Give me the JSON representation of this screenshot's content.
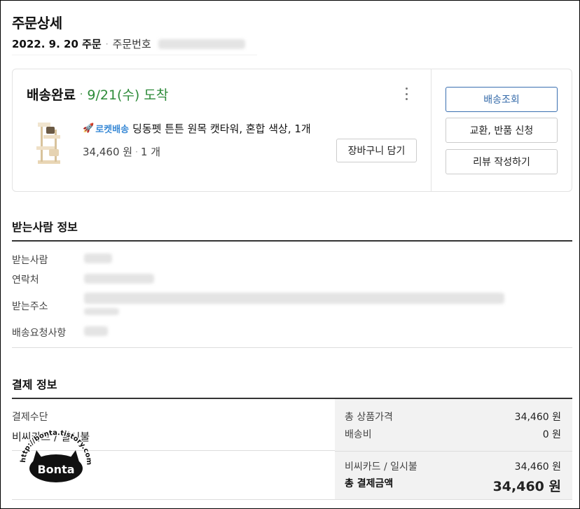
{
  "header": {
    "title": "주문상세",
    "order_date": "2022. 9. 20 주문",
    "order_no_label": "주문번호"
  },
  "shipment": {
    "status": "배송완료",
    "arrival": "9/21(수) 도착",
    "product_badge": "로켓배송",
    "product_name": "딩동펫 튼튼 원목 캣타워, 혼합 색상, 1개",
    "price": "34,460 원",
    "quantity": "1 개",
    "cart_button": "장바구니 담기",
    "actions": [
      "배송조회",
      "교환, 반품 신청",
      "리뷰 작성하기"
    ]
  },
  "recipient": {
    "title": "받는사람 정보",
    "labels": [
      "받는사람",
      "연락처",
      "받는주소",
      "배송요청사항"
    ]
  },
  "payment": {
    "title": "결제 정보",
    "method_label": "결제수단",
    "method_value": "비씨카드 / 일시불",
    "rows": [
      {
        "label": "총 상품가격",
        "amount": "34,460 원"
      },
      {
        "label": "배송비",
        "amount": "0 원"
      }
    ],
    "card_row": {
      "label": "비씨카드 / 일시불",
      "amount": "34,460 원"
    },
    "total_row": {
      "label": "총 결제금액",
      "amount": "34,460 원"
    }
  },
  "watermark": {
    "url": "http://bonta.tistory.com",
    "name": "Bonta"
  },
  "icons": {
    "more": "more-vertical-icon",
    "rocket": "rocket-icon"
  },
  "colors": {
    "arrival_green": "#2e8b3a",
    "rocket_blue": "#3a8ad6",
    "primary_button": "#346aa9"
  }
}
